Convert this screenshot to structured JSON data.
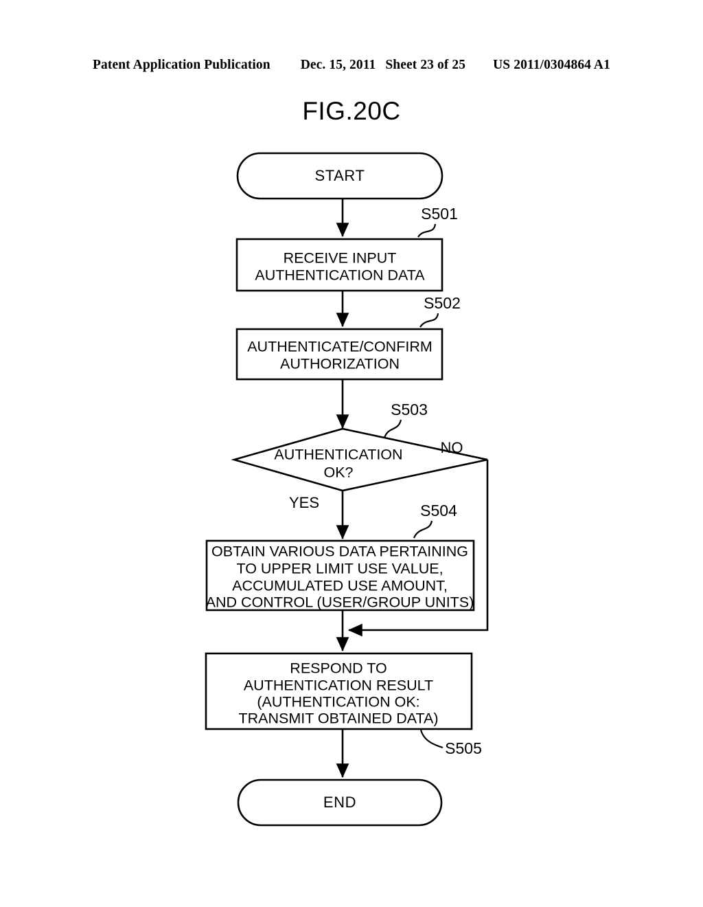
{
  "header": {
    "publication": "Patent Application Publication",
    "date": "Dec. 15, 2011",
    "sheet": "Sheet 23 of 25",
    "document_number": "US 2011/0304864 A1"
  },
  "figure": {
    "title": "FIG.20C"
  },
  "flowchart": {
    "nodes": {
      "start": {
        "type": "terminal",
        "label": "START"
      },
      "s501": {
        "type": "process",
        "step": "S501",
        "lines": [
          "RECEIVE INPUT",
          "AUTHENTICATION DATA"
        ]
      },
      "s502": {
        "type": "process",
        "step": "S502",
        "lines": [
          "AUTHENTICATE/CONFIRM",
          "AUTHORIZATION"
        ]
      },
      "s503": {
        "type": "decision",
        "step": "S503",
        "lines": [
          "AUTHENTICATION",
          "OK?"
        ],
        "yes_label": "YES",
        "no_label": "NO"
      },
      "s504": {
        "type": "process",
        "step": "S504",
        "lines": [
          "OBTAIN VARIOUS DATA PERTAINING",
          "TO UPPER LIMIT USE VALUE,",
          "ACCUMULATED USE AMOUNT,",
          "AND CONTROL (USER/GROUP UNITS)"
        ]
      },
      "s505": {
        "type": "process",
        "step": "S505",
        "lines": [
          "RESPOND TO",
          "AUTHENTICATION RESULT",
          "(AUTHENTICATION OK:",
          "TRANSMIT OBTAINED DATA)"
        ]
      },
      "end": {
        "type": "terminal",
        "label": "END"
      }
    },
    "colors": {
      "ink": "#000000",
      "paper": "#ffffff"
    }
  }
}
